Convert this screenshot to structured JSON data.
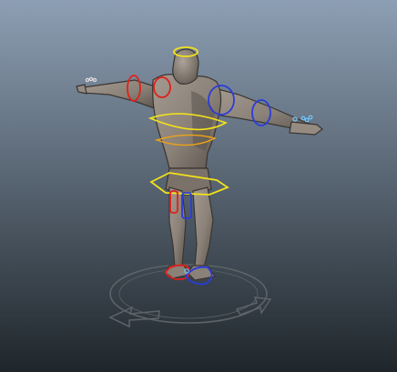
{
  "viewport": {
    "title": "",
    "background_top": "#8d9fb4",
    "background_bottom": "#1f262b"
  },
  "character": {
    "body_color": "#8a8178",
    "body_shadow": "#4f4943",
    "outline": "#3a3531"
  },
  "controls": {
    "left_color": "#e0201b",
    "right_color": "#2a3bdc",
    "center_color": "#f2e21b",
    "spine_color": "#f0a316",
    "finger_color": "#6ec8ff"
  },
  "ground": {
    "ring_color": "#5d6368",
    "arrow_color": "#5d6368"
  }
}
